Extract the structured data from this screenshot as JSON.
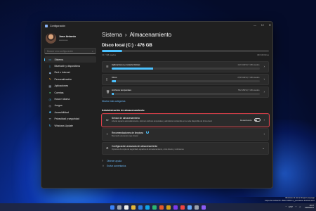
{
  "window": {
    "title": "Configuración",
    "controls": [
      "—",
      "☐",
      "✕"
    ]
  },
  "profile": {
    "name": "Jose Antonio",
    "email": "••••••••••••"
  },
  "search": {
    "placeholder": "Buscar una configuración"
  },
  "sidebar": {
    "items": [
      {
        "label": "Sistema",
        "icon": "monitor-icon"
      },
      {
        "label": "Bluetooth y dispositivos",
        "icon": "bluetooth-icon"
      },
      {
        "label": "Red e Internet",
        "icon": "network-icon"
      },
      {
        "label": "Personalización",
        "icon": "brush-icon"
      },
      {
        "label": "Aplicaciones",
        "icon": "apps-icon"
      },
      {
        "label": "Cuentas",
        "icon": "person-icon"
      },
      {
        "label": "Hora e idioma",
        "icon": "clock-globe-icon"
      },
      {
        "label": "Juegos",
        "icon": "gamepad-icon"
      },
      {
        "label": "Accesibilidad",
        "icon": "accessibility-icon"
      },
      {
        "label": "Privacidad y seguridad",
        "icon": "shield-icon"
      },
      {
        "label": "Windows Update",
        "icon": "update-icon"
      }
    ]
  },
  "breadcrumb": {
    "parent": "Sistema",
    "separator": "›",
    "current": "Almacenamiento"
  },
  "disk": {
    "title": "Disco local (C:) - 476 GB",
    "used_fraction": 0.12,
    "used_label": "13,7 GB usados",
    "free_label": "463 GB libres"
  },
  "categories": [
    {
      "label": "Aplicaciones y características",
      "size": "10,6 GB/13,7 GB usados",
      "fraction": 0.28,
      "icon": "apps-list-icon"
    },
    {
      "label": "Otros",
      "size": "2,58 GB/13,7 GB usados",
      "fraction": 0.03,
      "icon": "document-icon"
    },
    {
      "label": "Archivos temporales",
      "size": "552 MB/13,7 GB usados",
      "fraction": 0.015,
      "icon": "trash-icon"
    }
  ],
  "more_categories": "Mostrar más categorías",
  "management": {
    "title": "Administración de almacenamiento",
    "sensor": {
      "title": "Sensor de almacenamiento",
      "desc": "Liberar espacio automáticamente, eliminar archivos temporales y administrar contenido en la nube disponible de forma local",
      "state": "Desactivado"
    },
    "cleanup": {
      "title": "Recomendaciones de limpieza",
      "desc": "Buscando elementos que limpiar"
    },
    "advanced": {
      "title": "Configuración avanzada de almacenamiento",
      "desc": "Opciones de copia de seguridad, espacios de almacenamiento, otros discos y volúmenes"
    }
  },
  "footer": {
    "help": "Obtener ayuda",
    "feedback": "Enviar comentarios"
  },
  "watermark": {
    "line1": "Windows 11 Home Single Language",
    "line2": "Copia de evaluación. Build 22000.ni_prerelease.210610-1024"
  },
  "tray": {
    "lang": "ESP",
    "time": "10:17",
    "date": "23/06/2021"
  },
  "taskbar_colors": [
    "#3b82f6",
    "#9ca3af",
    "#f0f0f0",
    "#e6b83a",
    "#2d7de0",
    "#0ea5e9",
    "#2bb673",
    "#e35a2b",
    "#d4a017",
    "#7c3aed",
    "#ef4444",
    "#60a5fa",
    "#9ca3af",
    "#8b5cf6"
  ]
}
